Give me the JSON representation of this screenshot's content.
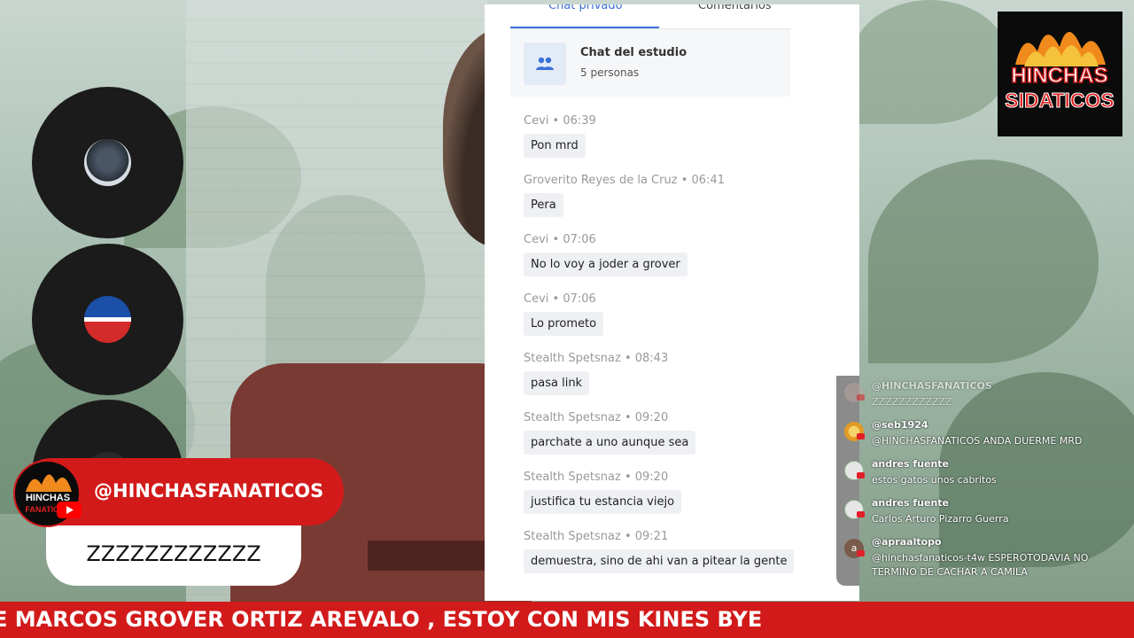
{
  "chat": {
    "tabs": [
      {
        "label": "Chat privado",
        "active": true
      },
      {
        "label": "Comentarios",
        "active": false
      }
    ],
    "group": {
      "title": "Chat del estudio",
      "subtitle": "5 personas",
      "icon": "people-icon"
    },
    "messages": [
      {
        "author": "Cevi",
        "time": "06:39",
        "text": "Pon mrd"
      },
      {
        "author": "Groverito Reyes de la Cruz",
        "time": "06:41",
        "text": "Pera"
      },
      {
        "author": "Cevi",
        "time": "07:06",
        "text": "No lo voy a joder a grover"
      },
      {
        "author": "Cevi",
        "time": "07:06",
        "text": "Lo prometo"
      },
      {
        "author": "Stealth Spetsnaz",
        "time": "08:43",
        "text": "pasa link"
      },
      {
        "author": "Stealth Spetsnaz",
        "time": "09:20",
        "text": "parchate a uno aunque sea"
      },
      {
        "author": "Stealth Spetsnaz",
        "time": "09:20",
        "text": "justifica tu estancia viejo"
      },
      {
        "author": "Stealth Spetsnaz",
        "time": "09:21",
        "text": "demuestra, sino de ahi van a pitear la gente"
      }
    ],
    "separator": "•"
  },
  "logo": {
    "line1": "HINCHAS",
    "line2": "SIDATICOS"
  },
  "live_comments": [
    {
      "user": "@HINCHASFANATICOS",
      "text": "ZZZZZZZZZZZZ",
      "faded": true
    },
    {
      "user": "@seb1924",
      "text": "@HINCHASFANATICOS ANDA DUERME MRD",
      "faded": false
    },
    {
      "user": "andres fuente",
      "text": "estos gatos unos cabritos",
      "faded": false
    },
    {
      "user": "andres fuente",
      "text": "Carlos Arturo Pizarro Guerra",
      "faded": false
    },
    {
      "user": "@apraaltopo",
      "text": "@hinchasfanaticos-t4w ESPEROTODAVIA NO TERMINO DE CACHAR A CAMILA",
      "faded": false,
      "avatar_letter": "a"
    }
  ],
  "featured": {
    "user": "@HINCHASFANATICOS",
    "message": "ZZZZZZZZZZZZ",
    "avatar_text1": "HINCHAS",
    "avatar_text2": "FANATICOS"
  },
  "ticker": {
    "text": "E MARCOS GROVER ORTIZ AREVALO , ESTOY CON MIS KINES BYE"
  },
  "colors": {
    "accent_red": "#d21a1a",
    "tab_blue": "#3a6fd8",
    "youtube_red": "#ff0000"
  }
}
